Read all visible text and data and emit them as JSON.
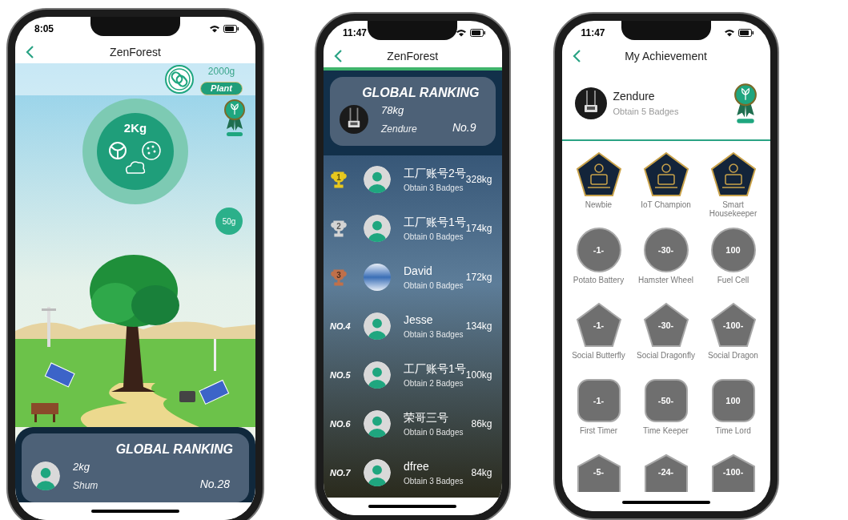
{
  "phones": [
    {
      "kind": "forest",
      "status_time": "8:05",
      "title": "ZenForest",
      "target": "2000g",
      "plant_button": "Plant",
      "total": "2Kg",
      "bubble": "50g",
      "ranking": {
        "title": "GLOBAL RANKING",
        "weight": "2kg",
        "name": "Shum",
        "rank": "No.28",
        "avatar": {
          "kind": "default"
        }
      }
    },
    {
      "kind": "ranking",
      "status_time": "11:47",
      "title": "ZenForest",
      "ranking": {
        "title": "GLOBAL RANKING",
        "weight": "78kg",
        "name": "Zendure",
        "rank": "No.9",
        "avatar": {
          "kind": "device"
        }
      },
      "rows": [
        {
          "rank": "1",
          "kind": "trophy",
          "color": "#e8c81e",
          "avatar": {
            "kind": "default"
          },
          "name": "工厂账号2号",
          "badges": "Obtain 3 Badges",
          "weight": "328kg"
        },
        {
          "rank": "2",
          "kind": "trophy",
          "color": "#d4d4d4",
          "avatar": {
            "kind": "default"
          },
          "name": "工厂账号1号",
          "badges": "Obtain 0 Badges",
          "weight": "174kg"
        },
        {
          "rank": "3",
          "kind": "trophy",
          "color": "#c0704a",
          "avatar": {
            "kind": "photo"
          },
          "name": "David",
          "badges": "Obtain 0 Badges",
          "weight": "172kg"
        },
        {
          "rank": "NO.4",
          "kind": "text",
          "avatar": {
            "kind": "default"
          },
          "name": "Jesse",
          "badges": "Obtain 3 Badges",
          "weight": "134kg"
        },
        {
          "rank": "NO.5",
          "kind": "text",
          "avatar": {
            "kind": "default"
          },
          "name": "工厂账号1号",
          "badges": "Obtain 2 Badges",
          "weight": "100kg"
        },
        {
          "rank": "NO.6",
          "kind": "text",
          "avatar": {
            "kind": "default"
          },
          "name": "荣哥三号",
          "badges": "Obtain 0 Badges",
          "weight": "86kg"
        },
        {
          "rank": "NO.7",
          "kind": "text",
          "avatar": {
            "kind": "default"
          },
          "name": "dfree",
          "badges": "Obtain 3 Badges",
          "weight": "84kg"
        }
      ]
    },
    {
      "kind": "achievement",
      "status_time": "11:47",
      "title": "My Achievement",
      "user": "Zendure",
      "subtitle": "Obtain 5 Badges",
      "avatar": {
        "kind": "device"
      },
      "badges": [
        {
          "kind": "pentagon",
          "earned": true,
          "label": "Newbie"
        },
        {
          "kind": "pentagon",
          "earned": true,
          "label": "IoT Champion"
        },
        {
          "kind": "pentagon",
          "earned": true,
          "label": "Smart Housekeeper"
        },
        {
          "kind": "circle",
          "earned": false,
          "mark": "-1-",
          "label": "Potato Battery"
        },
        {
          "kind": "circle",
          "earned": false,
          "mark": "-30-",
          "label": "Hamster Wheel"
        },
        {
          "kind": "circle",
          "earned": false,
          "mark": "100",
          "label": "Fuel Cell"
        },
        {
          "kind": "pentagon",
          "earned": false,
          "mark": "-1-",
          "label": "Social Butterfly"
        },
        {
          "kind": "pentagon",
          "earned": false,
          "mark": "-30-",
          "label": "Social Dragonfly"
        },
        {
          "kind": "pentagon",
          "earned": false,
          "mark": "-100-",
          "label": "Social Dragon"
        },
        {
          "kind": "rounded-square",
          "earned": false,
          "mark": "-1-",
          "label": "First Timer"
        },
        {
          "kind": "rounded-square",
          "earned": false,
          "mark": "-50-",
          "label": "Time Keeper"
        },
        {
          "kind": "rounded-square",
          "earned": false,
          "mark": "100",
          "label": "Time Lord"
        },
        {
          "kind": "house",
          "earned": false,
          "mark": "-5-"
        },
        {
          "kind": "house",
          "earned": false,
          "mark": "-24-"
        },
        {
          "kind": "house",
          "earned": false,
          "mark": "-100-"
        }
      ]
    }
  ]
}
